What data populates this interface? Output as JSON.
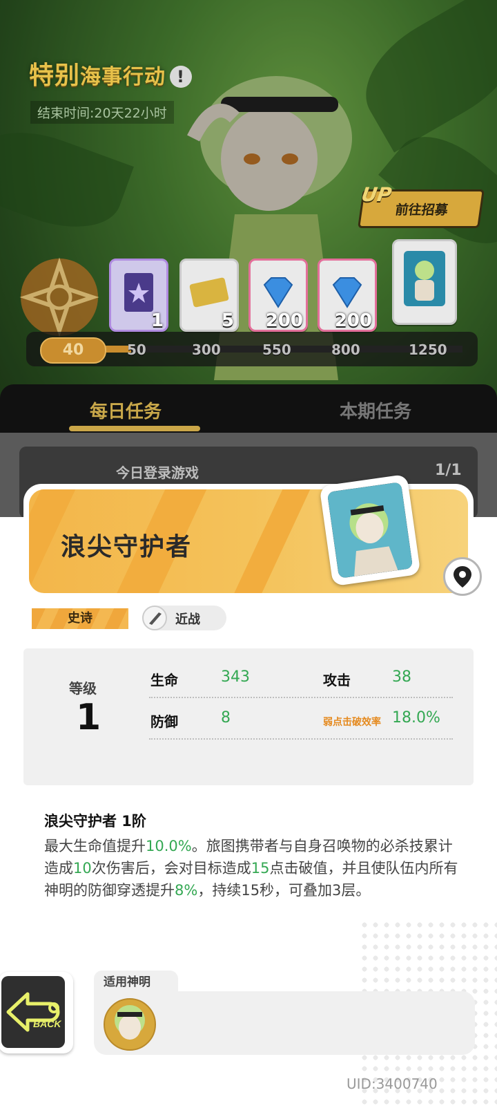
{
  "event": {
    "title_big": "特别",
    "title_small": "海事行动",
    "info_icon": "exclamation-icon",
    "end_time": "结束时间:20天22小时",
    "up_badge": "UP",
    "recruit_label": "前往招募"
  },
  "rewards": [
    {
      "icon": "book-star-icon",
      "count": "1",
      "tier": "purple"
    },
    {
      "icon": "ticket-icon",
      "count": "5",
      "tier": "normal"
    },
    {
      "icon": "diamond-icon",
      "count": "200",
      "tier": "pink"
    },
    {
      "icon": "diamond-icon",
      "count": "200",
      "tier": "pink"
    },
    {
      "icon": "character-card-icon",
      "count": "",
      "tier": "normal"
    }
  ],
  "progress": {
    "current": "40",
    "milestones": [
      "50",
      "300",
      "550",
      "800",
      "1250"
    ]
  },
  "tabs": {
    "daily": "每日任务",
    "period": "本期任务"
  },
  "task": {
    "title": "今日登录游戏",
    "count": "1/1"
  },
  "card": {
    "name": "浪尖守护者",
    "rarity": "史诗",
    "type": "近战",
    "level_label": "等级",
    "level": "1",
    "stats": {
      "hp_label": "生命",
      "hp": "343",
      "atk_label": "攻击",
      "atk": "38",
      "def_label": "防御",
      "def": "8",
      "break_label": "弱点击破效率",
      "break": "18.0%"
    },
    "skill_title": "浪尖守护者 1阶",
    "skill_desc": {
      "p1": "最大生命值提升",
      "v1": "10.0%",
      "p2": "。旅图携带者与自身召唤物的必杀技累计造成",
      "v2": "10",
      "p3": "次伤害后，会对目标造成",
      "v3": "15",
      "p4": "点击破值，并且使队伍内所有神明的防御穿透提升",
      "v4": "8%",
      "p5": "，持续15秒，可叠加3层。"
    },
    "applicable_label": "适用神明"
  },
  "back_label": "BACK",
  "uid": "UID:3400740",
  "colors": {
    "accent_gold": "#caa648",
    "stat_green": "#34a853",
    "epic_orange": "#f0a73c",
    "break_orange": "#e58a1f"
  }
}
